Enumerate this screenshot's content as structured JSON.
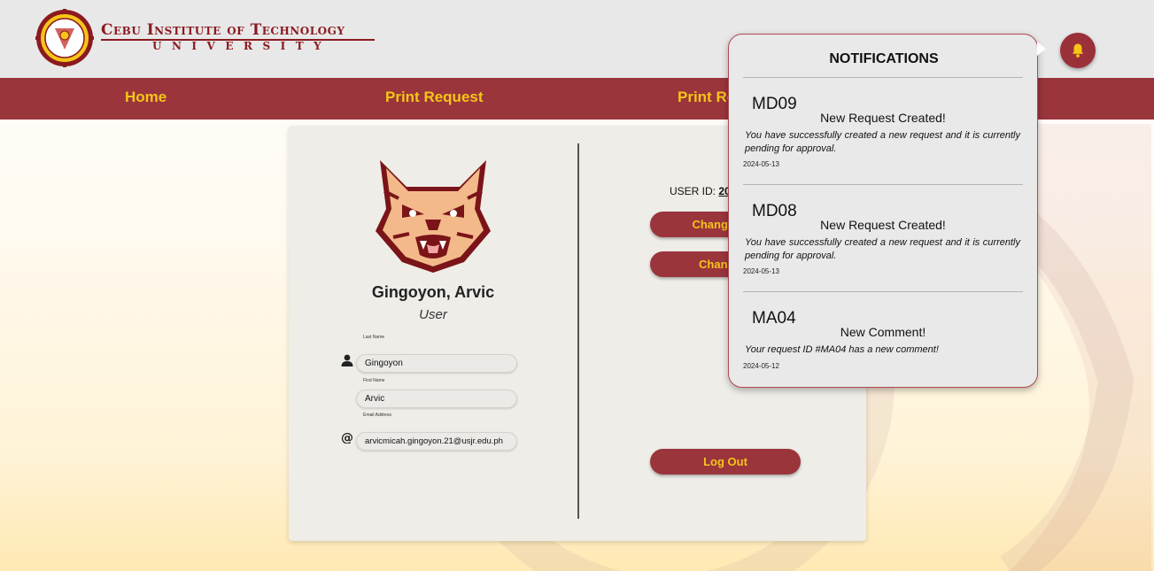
{
  "header": {
    "logo_line1": "Cebu Institute of Technology",
    "logo_line2": "UNIVERSITY"
  },
  "nav": {
    "home": "Home",
    "print_request": "Print Request",
    "print_request_2": "Print Re"
  },
  "profile": {
    "name": "Gingoyon, Arvic",
    "role": "User",
    "last_name_label": "Last Name",
    "last_name": "Gingoyon",
    "first_name_label": "First Name",
    "first_name": "Arvic",
    "email_label": "Email Address",
    "email": "arvicmicah.gingoyon.21@usjr.edu.ph"
  },
  "account": {
    "user_id_label": "USER ID:",
    "user_id_value": "20",
    "change_info": "Change Info",
    "change_password": "Change P",
    "logout": "Log Out"
  },
  "notifications": {
    "title": "NOTIFICATIONS",
    "items": [
      {
        "id": "MD09",
        "heading": "New Request Created!",
        "body": "You have successfully created a new request and it is currently pending for approval.",
        "date": "2024-05-13"
      },
      {
        "id": "MD08",
        "heading": "New Request Created!",
        "body": "You have successfully created a new request and it is currently pending for approval.",
        "date": "2024-05-13"
      },
      {
        "id": "MA04",
        "heading": "New Comment!",
        "body": "Your request ID #MA04 has a new comment!",
        "date": "2024-05-12"
      }
    ]
  },
  "colors": {
    "maroon": "#9a353c",
    "gold": "#f5c518",
    "header_bg": "#e8e8e8"
  },
  "icons": {
    "bell": "bell-icon",
    "user": "user-icon",
    "at": "at-icon"
  }
}
